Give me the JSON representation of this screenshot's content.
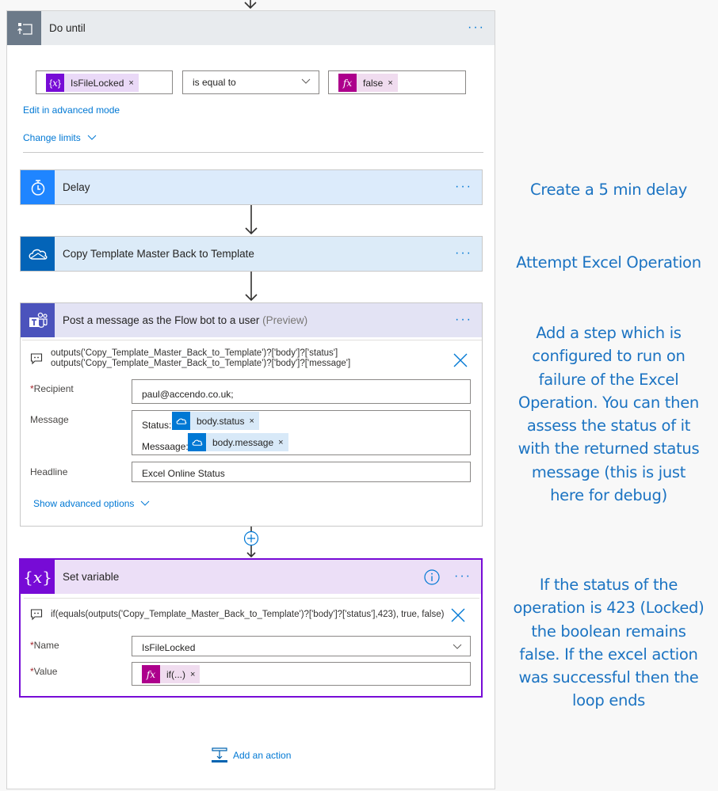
{
  "do_until": {
    "title": "Do until",
    "more_label": "···",
    "condition": {
      "left_token": {
        "icon": "variable-icon",
        "label": "IsFileLocked",
        "remove": "×"
      },
      "operator": "is equal to",
      "right_token": {
        "icon": "fx-icon",
        "label": "false",
        "remove": "×"
      }
    },
    "edit_advanced": "Edit in advanced mode",
    "change_limits": "Change limits"
  },
  "actions": {
    "delay": {
      "title": "Delay",
      "more_label": "···",
      "icon": "timer-icon"
    },
    "copy": {
      "title": "Copy Template Master Back to Template",
      "more_label": "···",
      "icon": "onedrive-icon"
    },
    "post": {
      "title": "Post a message as the Flow bot to a user",
      "preview": "(Preview)",
      "more_label": "···",
      "icon": "teams-icon",
      "expression_line1": "outputs('Copy_Template_Master_Back_to_Template')?['body']?['status']",
      "expression_line2": "outputs('Copy_Template_Master_Back_to_Template')?['body']?['message']",
      "fields": {
        "recipient_label": "Recipient",
        "recipient_value": "paul@accendo.co.uk;",
        "message_label": "Message",
        "status_prefix": "Status:",
        "status_token": "body.status",
        "message_prefix": "Messaage:",
        "message_token": "body.message",
        "remove": "×",
        "headline_label": "Headline",
        "headline_value": "Excel Online Status"
      },
      "show_advanced": "Show advanced options"
    },
    "set_variable": {
      "title": "Set variable",
      "more_label": "···",
      "icon": "variable-icon",
      "expression": "if(equals(outputs('Copy_Template_Master_Back_to_Template')?['body']?['status'],423), true, false)",
      "name_label": "Name",
      "name_value": "IsFileLocked",
      "value_label": "Value",
      "value_token": "if(...)",
      "remove": "×"
    }
  },
  "required_mark": "*",
  "add_action": "Add an action",
  "notes": {
    "delay": "Create a 5 min delay",
    "excel": "Attempt Excel Operation",
    "failure": "Add a step which is configured to run on failure of the Excel Operation. You can then assess the status of it with the returned status message (this is just here for debug)",
    "status": "If the status of the operation is 423 (Locked) the boolean remains false. If the excel action was successful then the loop ends"
  },
  "colors": {
    "accent": "#0078d4",
    "variable": "#770bd6",
    "fx": "#ad008c",
    "teams": "#4b53bc",
    "loop": "#6c7a89",
    "note_text": "#1b73c2"
  }
}
